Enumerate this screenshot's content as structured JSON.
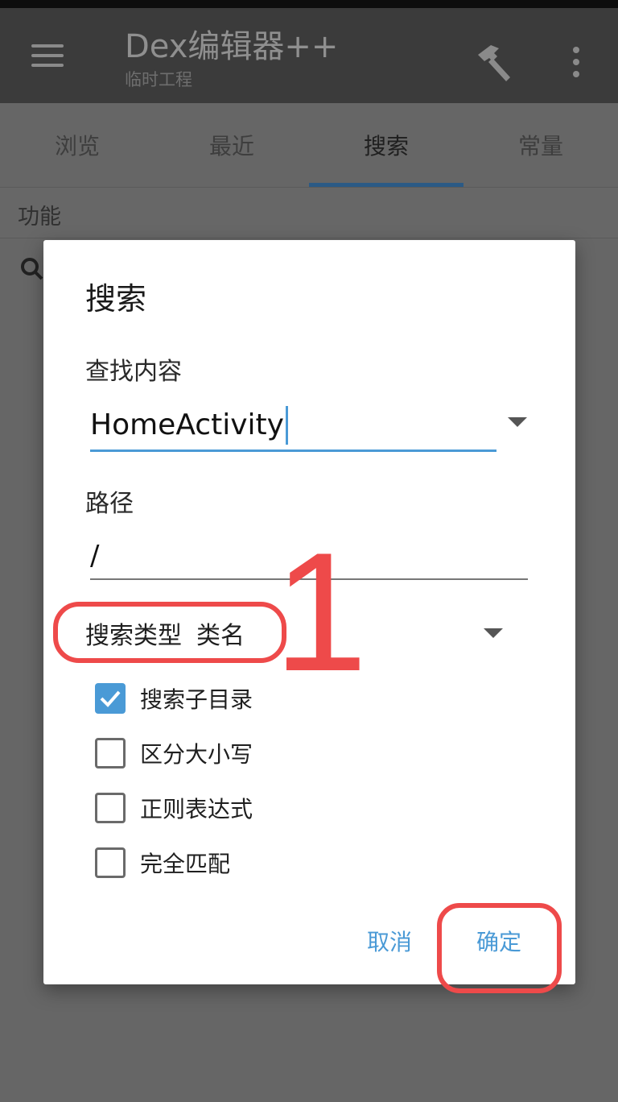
{
  "app_bar": {
    "title": "Dex编辑器++",
    "subtitle": "临时工程",
    "menu_icon": "hamburger-menu-icon",
    "build_icon": "hammer-icon",
    "overflow_icon": "more-vert-icon"
  },
  "tabs": [
    {
      "label": "浏览",
      "active": false
    },
    {
      "label": "最近",
      "active": false
    },
    {
      "label": "搜索",
      "active": true
    },
    {
      "label": "常量",
      "active": false
    }
  ],
  "section": {
    "label": "功能"
  },
  "dialog": {
    "title": "搜索",
    "find_label": "查找内容",
    "find_value": "HomeActivity",
    "path_label": "路径",
    "path_value": "/",
    "search_type_label": "搜索类型",
    "search_type_value": "类名",
    "checkboxes": [
      {
        "label": "搜索子目录",
        "checked": true
      },
      {
        "label": "区分大小写",
        "checked": false
      },
      {
        "label": "正则表达式",
        "checked": false
      },
      {
        "label": "完全匹配",
        "checked": false
      }
    ],
    "cancel_label": "取消",
    "ok_label": "确定"
  },
  "annotation": {
    "step_number": "1",
    "color": "#ee4a4a"
  },
  "colors": {
    "accent": "#4a9ad6",
    "app_bar": "#3b3b3b",
    "scrim": "#666666"
  }
}
